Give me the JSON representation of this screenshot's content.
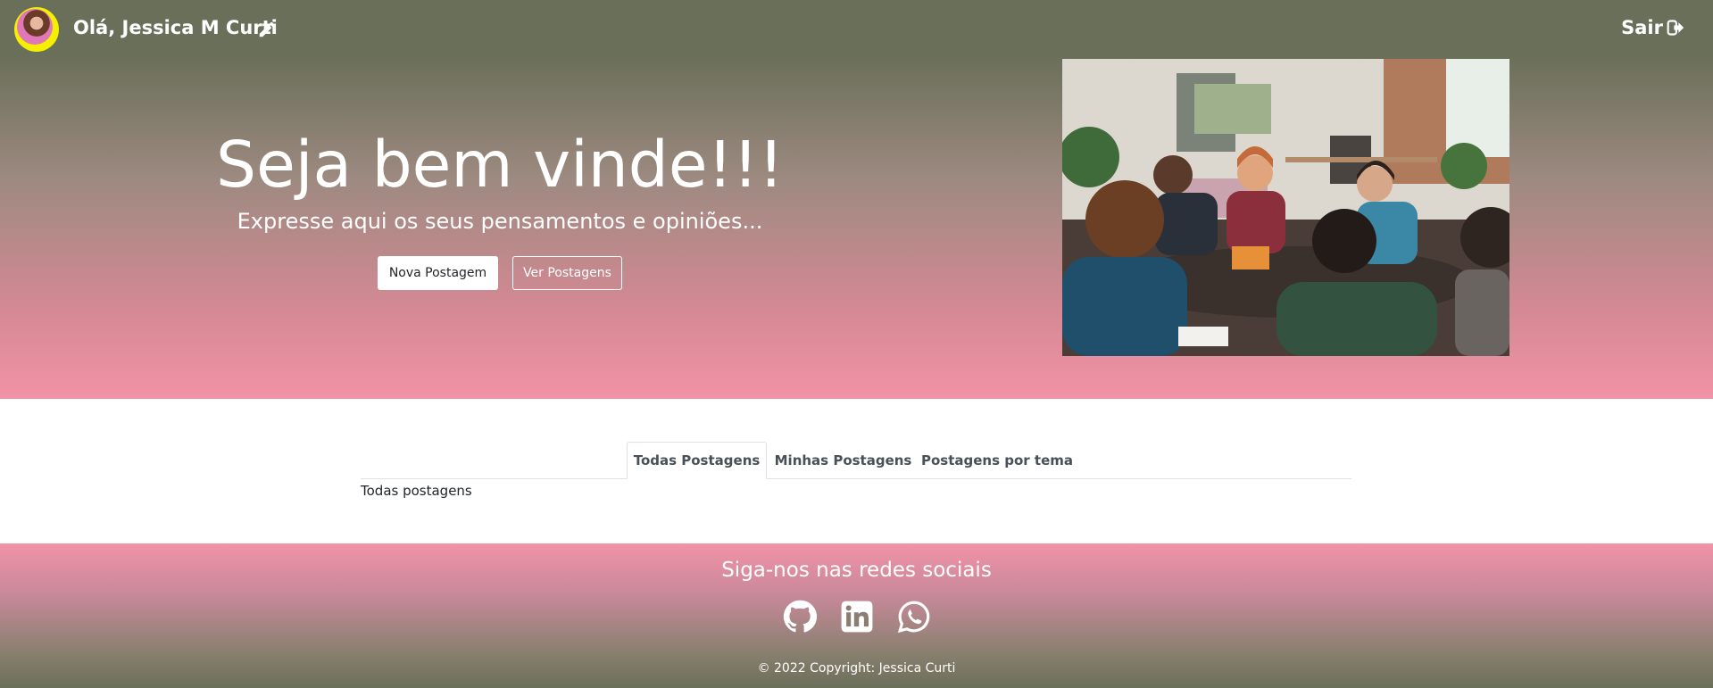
{
  "header": {
    "greeting": "Olá, Jessica M Curti",
    "logout_label": "Sair"
  },
  "hero": {
    "title": "Seja bem vinde!!!",
    "subtitle": "Expresse aqui os seus pensamentos e opiniões...",
    "new_post_label": "Nova Postagem",
    "view_posts_label": "Ver Postagens"
  },
  "tabs": [
    {
      "label": "Todas Postagens",
      "active": true
    },
    {
      "label": "Minhas Postagens",
      "active": false
    },
    {
      "label": "Postagens por tema",
      "active": false
    }
  ],
  "tab_content": "Todas postagens",
  "footer": {
    "title": "Siga-nos nas redes sociais",
    "social_icons": [
      "github-icon",
      "linkedin-icon",
      "whatsapp-icon"
    ],
    "copyright": "© 2022 Copyright: Jessica Curti"
  },
  "colors": {
    "header_top": "#6a6f5a",
    "accent_pink": "#f292a7"
  }
}
